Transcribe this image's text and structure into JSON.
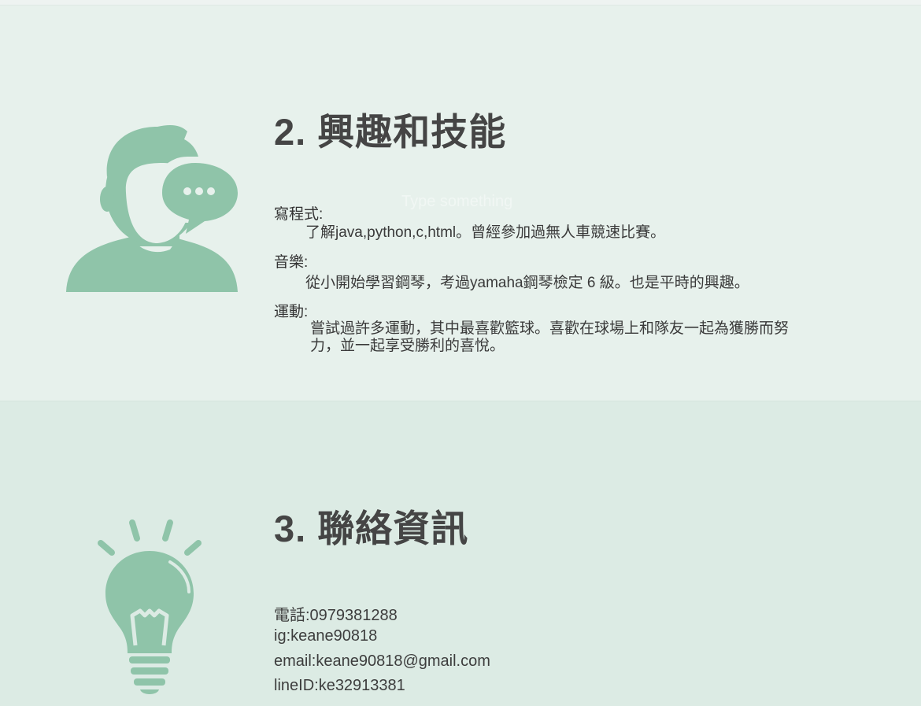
{
  "skills": {
    "title": "2. 興趣和技能",
    "placeholder": "Type something",
    "items": [
      {
        "label": "寫程式:",
        "desc": "了解java,python,c,html。曾經參加過無人車競速比賽。"
      },
      {
        "label": "音樂:",
        "desc": "從小開始學習鋼琴，考過yamaha鋼琴檢定 6 級。也是平時的興趣。"
      },
      {
        "label": "運動:",
        "desc_line1": "嘗試過許多運動，其中最喜歡籃球。喜歡在球場上和隊友一起為獲勝而努",
        "desc_line2": "力，並一起享受勝利的喜悅。"
      }
    ]
  },
  "contact": {
    "title": "3. 聯絡資訊",
    "lines": [
      "電話:0979381288",
      "ig:keane90818",
      "email:keane90818@gmail.com",
      "lineID:ke32913381"
    ]
  },
  "colors": {
    "icon": "#8fc4a9",
    "bg_skills": "#e7f1ec",
    "bg_contact": "#dcebe4"
  },
  "icons": {
    "skills": "person-chat-icon",
    "contact": "lightbulb-icon"
  }
}
